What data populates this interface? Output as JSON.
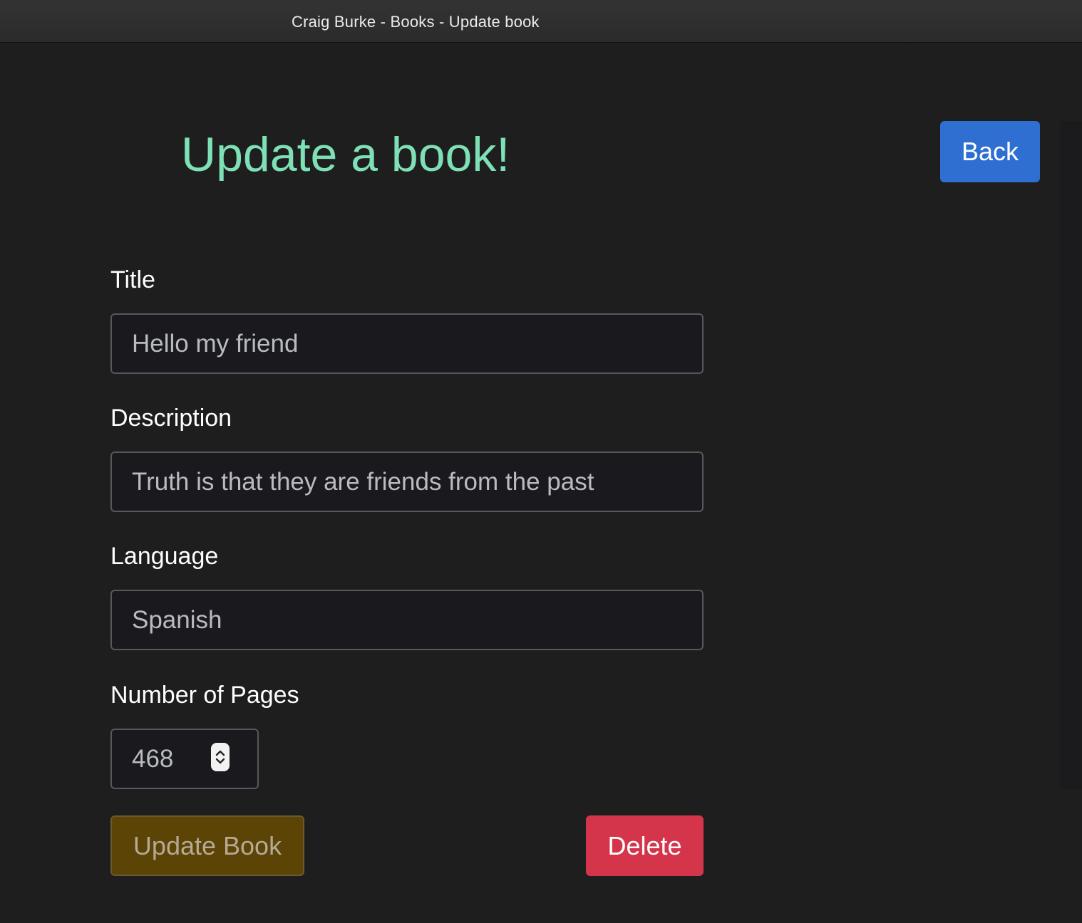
{
  "window": {
    "title": "Craig Burke - Books - Update book"
  },
  "header": {
    "title": "Update a book!",
    "back_label": "Back"
  },
  "form": {
    "title": {
      "label": "Title",
      "value": "Hello my friend"
    },
    "description": {
      "label": "Description",
      "value": "Truth is that they are friends from the past"
    },
    "language": {
      "label": "Language",
      "value": "Spanish"
    },
    "pages": {
      "label": "Number of Pages",
      "value": "468"
    },
    "update_label": "Update Book",
    "delete_label": "Delete"
  },
  "colors": {
    "title_accent": "#7ee0b5",
    "back_button": "#2f6fd1",
    "update_button": "#5c4306",
    "delete_button": "#d5354b"
  },
  "icons": {
    "stepper": "stepper-up-down-icon"
  }
}
